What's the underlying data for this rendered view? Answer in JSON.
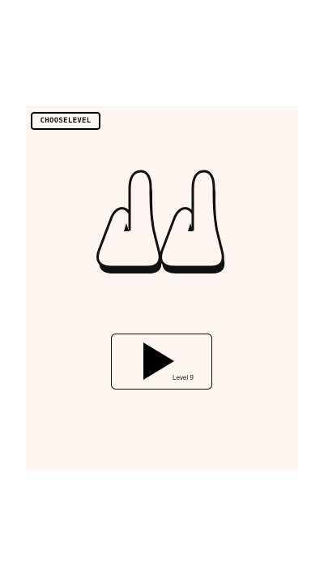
{
  "header": {
    "choose_level_label": "CHOOSELEVEL"
  },
  "logo": {
    "icon": "double-hand-logo-icon"
  },
  "play": {
    "icon": "play-triangle-icon",
    "level_label": "Level 9"
  },
  "colors": {
    "background": "#fdf5f1",
    "ink": "#111111"
  }
}
